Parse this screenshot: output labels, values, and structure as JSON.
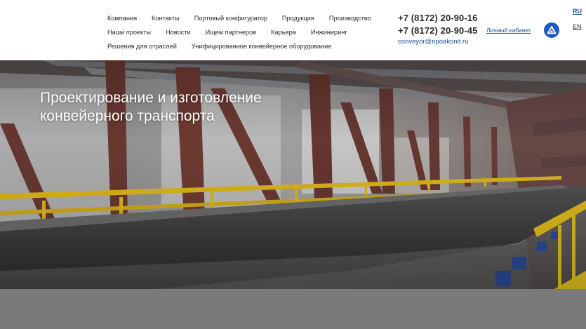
{
  "nav": {
    "row1": [
      "Компания",
      "Контакты",
      "Портовый конфигуратор",
      "Продукция",
      "Производство"
    ],
    "row2": [
      "Наши проекты",
      "Новости",
      "Ищем партнеров",
      "Карьера",
      "Инжиниринг"
    ],
    "row3": [
      "Решения для отраслей",
      "Унифицированное конвейерное оборудование"
    ]
  },
  "contacts": {
    "phone1": "+7 (8172) 20-90-16",
    "phone2": "+7 (8172) 20-90-45",
    "email": "conveyor@npoakonit.ru"
  },
  "account": {
    "cabinet_label": "Личный кабинет"
  },
  "lang": {
    "ru": "RU",
    "en": "EN"
  },
  "hero": {
    "title_line1": "Проектирование и изготовление",
    "title_line2": "конвейерного транспорта"
  },
  "colors": {
    "brand_blue": "#1d5bbf",
    "link_blue": "#1f4f9e",
    "railing_yellow": "#e8c21d",
    "steel_red": "#7a3a32"
  },
  "icons": {
    "logo": "triangle-logo-icon"
  }
}
